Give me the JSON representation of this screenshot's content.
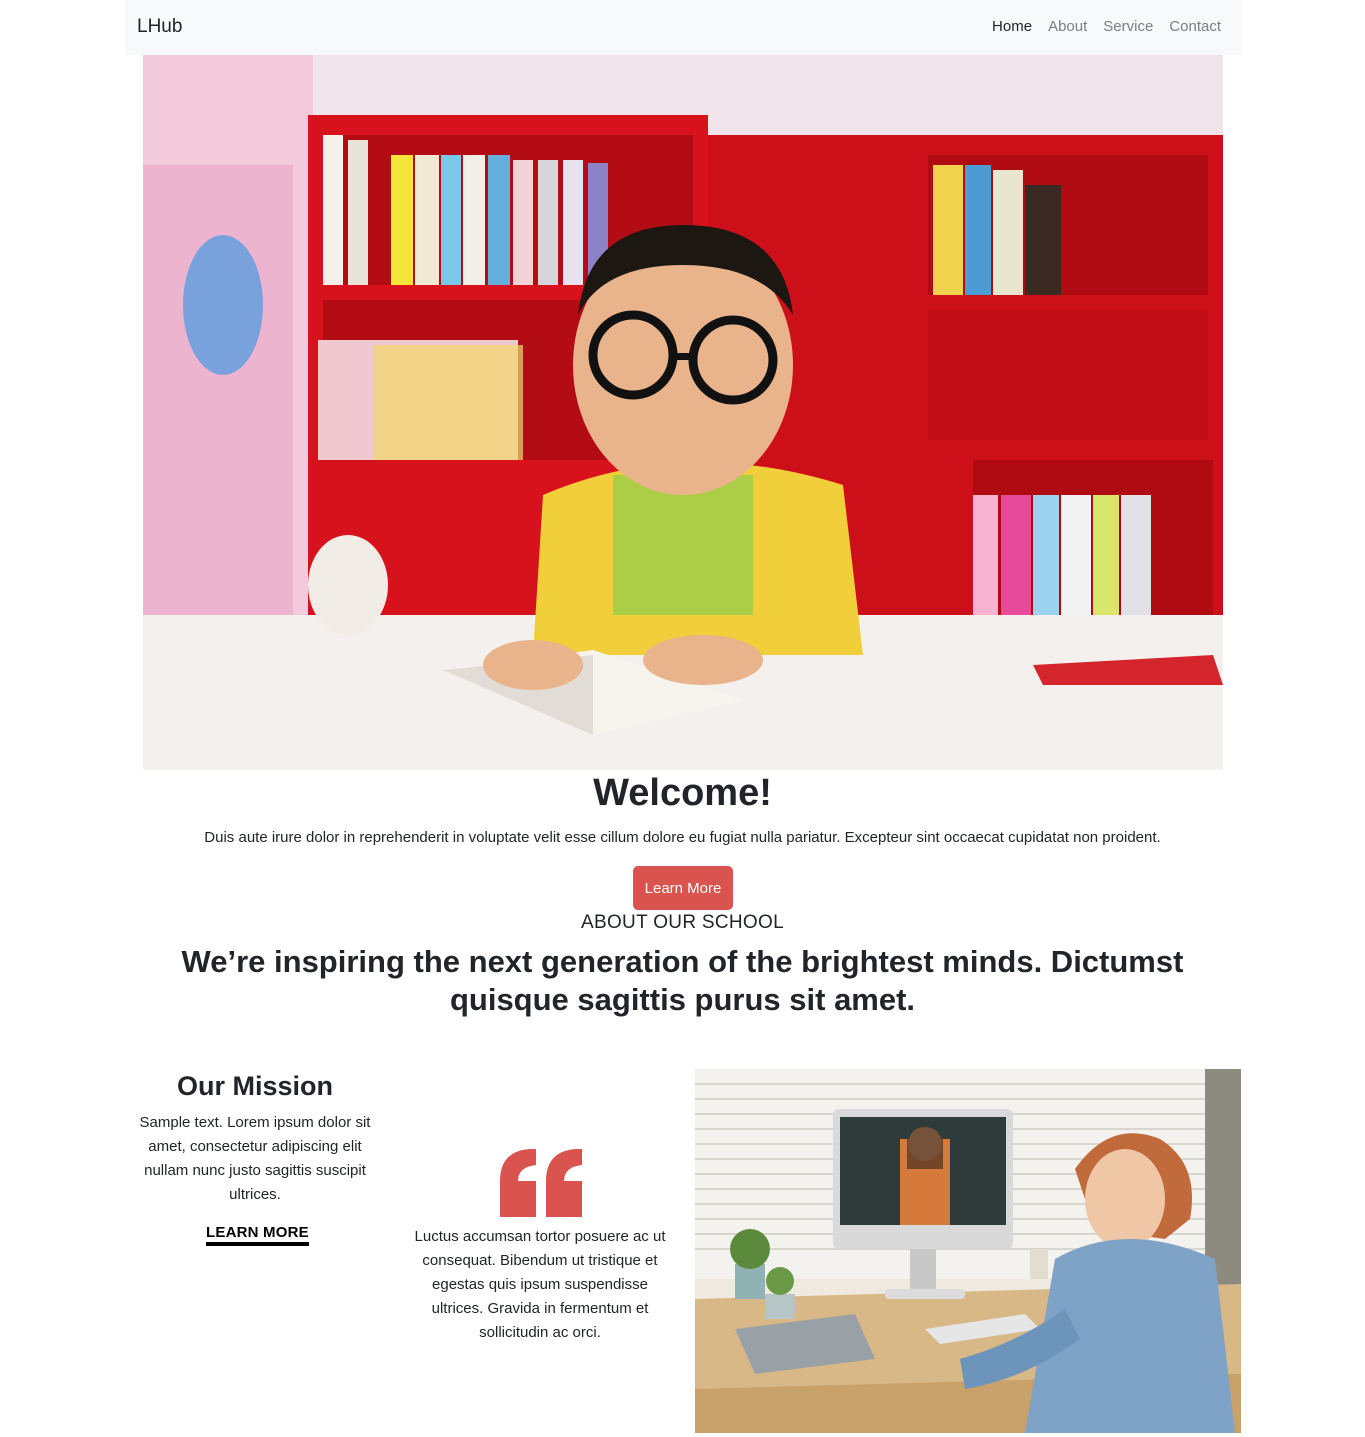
{
  "navbar": {
    "brand": "LHub",
    "links": [
      {
        "label": "Home",
        "active": true
      },
      {
        "label": "About",
        "active": false
      },
      {
        "label": "Service",
        "active": false
      },
      {
        "label": "Contact",
        "active": false
      }
    ]
  },
  "welcome": {
    "title": "Welcome!",
    "text": "Duis aute irure dolor in reprehenderit in voluptate velit esse cillum dolore eu fugiat nulla pariatur. Excepteur sint occaecat cupidatat non proident.",
    "button": "Learn More"
  },
  "about": {
    "kicker": "ABOUT OUR SCHOOL",
    "heading_parts": [
      "We’re inspiring the next ",
      "generation",
      " of the ",
      "brightest minds",
      ". Dictumst quisque sagittis purus sit amet."
    ]
  },
  "mission": {
    "title": "Our Mission",
    "text": "Sample text. Lorem ipsum dolor sit amet, consectetur adipiscing elit nullam nunc justo sagittis suscipit ultrices.",
    "link": "LEARN MORE"
  },
  "quote": {
    "icon": "quote-icon",
    "text": "Luctus accumsan tortor posuere ac ut consequat. Bibendum ut tristique et egestas quis ipsum suspendisse ultrices. Gravida in fermentum et sollicitudin ac orci."
  },
  "colors": {
    "accent": "#d9534f",
    "navbar_bg": "#f8f9fa",
    "text": "#212529"
  }
}
